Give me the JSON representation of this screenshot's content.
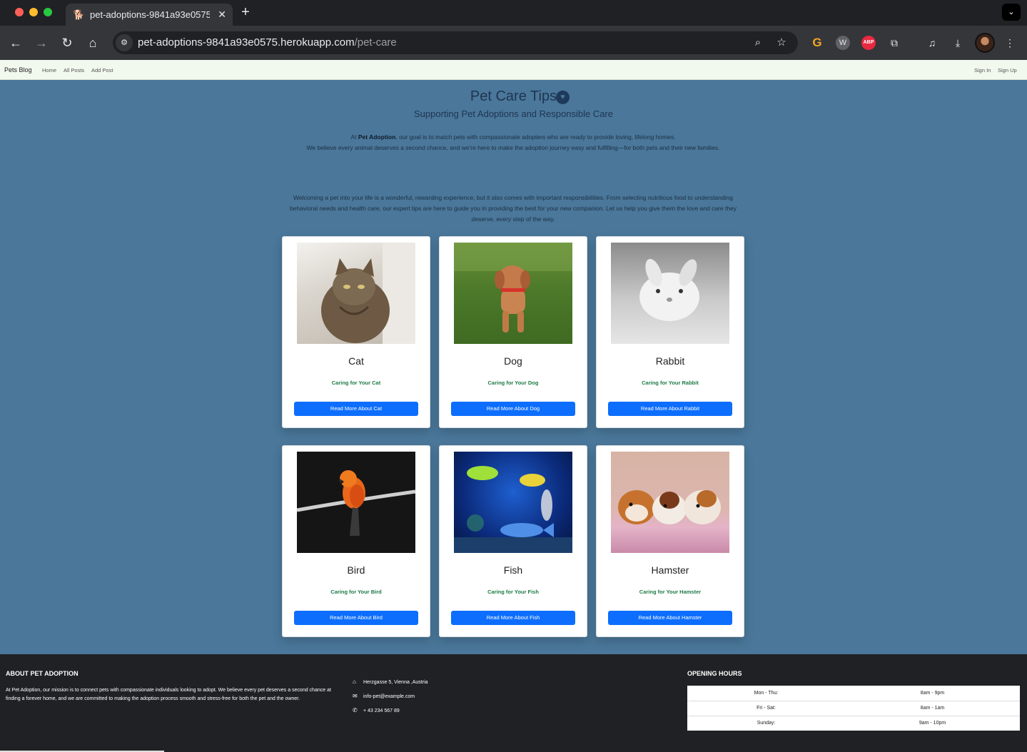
{
  "browser": {
    "tab_title": "pet-adoptions-9841a93e0575",
    "url_host": "pet-adoptions-9841a93e0575.herokuapp.com",
    "url_path": "/pet-care"
  },
  "nav": {
    "brand": "Pets Blog",
    "links": [
      "Home",
      "All Posts",
      "Add Post"
    ],
    "auth": [
      "Sign In",
      "Sign Up"
    ]
  },
  "hero": {
    "title": "Pet Care Tips",
    "subtitle": "Supporting Pet Adoptions and Responsible Care",
    "intro_prefix": "At ",
    "intro_bold": "Pet Adoption",
    "intro_line1_rest": ", our goal is to match pets with compassionate adopters who are ready to provide loving, lifelong homes.",
    "intro_line2": "We believe every animal deserves a second chance, and we're here to make the adoption journey easy and fulfilling—for both pets and their new families.",
    "welcome": "Welcoming a pet into your life is a wonderful, rewarding experience, but it also comes with important responsibilities. From selecting nutritious food to understanding behavioral needs and health care, our expert tips are here to guide you in providing the best for your new companion. Let us help you give them the love and care they deserve, every step of the way."
  },
  "cards": [
    {
      "title": "Cat",
      "subtitle": "Caring for Your Cat",
      "button": "Read More About Cat",
      "image": "cat-photo"
    },
    {
      "title": "Dog",
      "subtitle": "Caring for Your Dog",
      "button": "Read More About Dog",
      "image": "dog-photo"
    },
    {
      "title": "Rabbit",
      "subtitle": "Caring for Your Rabbit",
      "button": "Read More About Rabbit",
      "image": "rabbit-photo"
    },
    {
      "title": "Bird",
      "subtitle": "Caring for Your Bird",
      "button": "Read More About Bird",
      "image": "bird-photo"
    },
    {
      "title": "Fish",
      "subtitle": "Caring for Your Fish",
      "button": "Read More About Fish",
      "image": "fish-photo"
    },
    {
      "title": "Hamster",
      "subtitle": "Caring for Your Hamster",
      "button": "Read More About Hamster",
      "image": "hamster-photo"
    }
  ],
  "footer": {
    "about_heading": "ABOUT PET ADOPTION",
    "about_text": "At Pet Adoption, our mission is to connect pets with compassionate individuals looking to adopt. We believe every pet deserves a second chance at finding a forever home, and we are committed to making the adoption process smooth and stress-free for both the pet and the owner.",
    "address": "Herzgasse 5, Vienna ,Austria",
    "email": "info-pet@example.com",
    "phone": "+ 43 234 567 89",
    "hours_heading": "OPENING HOURS",
    "hours": [
      {
        "day": "Mon - Thu:",
        "time": "8am - 9pm"
      },
      {
        "day": "Fri - Sat:",
        "time": "8am - 1am"
      },
      {
        "day": "Sunday:",
        "time": "9am - 10pm"
      }
    ]
  },
  "colors": {
    "page_bg": "#4a779a",
    "button": "#0d6efd",
    "subtitle_green": "#1e7b45",
    "footer_bg": "#1f2124",
    "nav_bg": "#f1f8ee"
  }
}
